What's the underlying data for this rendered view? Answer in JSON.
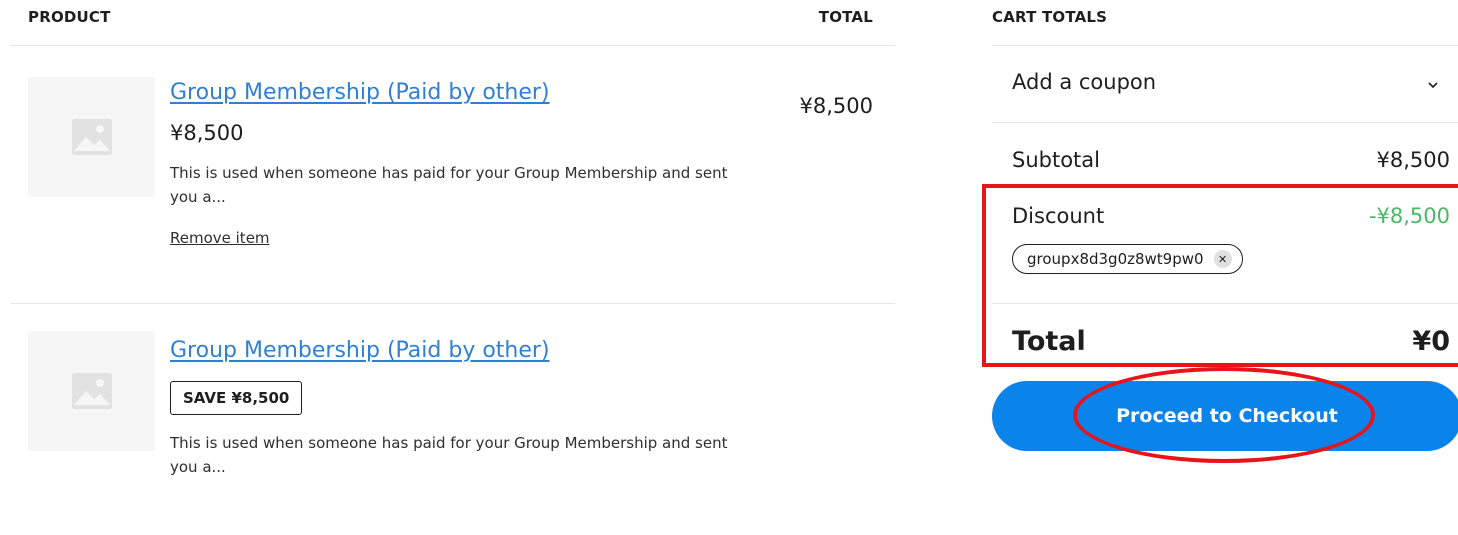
{
  "cart": {
    "headers": {
      "product": "PRODUCT",
      "total": "TOTAL"
    },
    "items": [
      {
        "name": "Group Membership (Paid by other)",
        "price": "¥8,500",
        "description": "This is used when someone has paid for your Group Membership and sent you a...",
        "remove_label": "Remove item",
        "line_total": "¥8,500"
      },
      {
        "name": "Group Membership (Paid by other)",
        "save_badge": "SAVE ¥8,500",
        "description": "This is used when someone has paid for your Group Membership and sent you a..."
      }
    ]
  },
  "totals": {
    "title": "CART TOTALS",
    "coupon_label": "Add a coupon",
    "subtotal_label": "Subtotal",
    "subtotal_value": "¥8,500",
    "discount_label": "Discount",
    "discount_value": "-¥8,500",
    "coupon_code": "groupx8d3g0z8wt9pw0",
    "total_label": "Total",
    "total_value": "¥0",
    "checkout_label": "Proceed to Checkout"
  },
  "colors": {
    "link": "#2f7fd6",
    "discount_green": "#4ab866",
    "checkout_blue": "#0a84ea",
    "annotation_red": "#e8131b"
  },
  "icons": [
    "image-placeholder-icon",
    "chevron-down-icon",
    "close-icon"
  ]
}
